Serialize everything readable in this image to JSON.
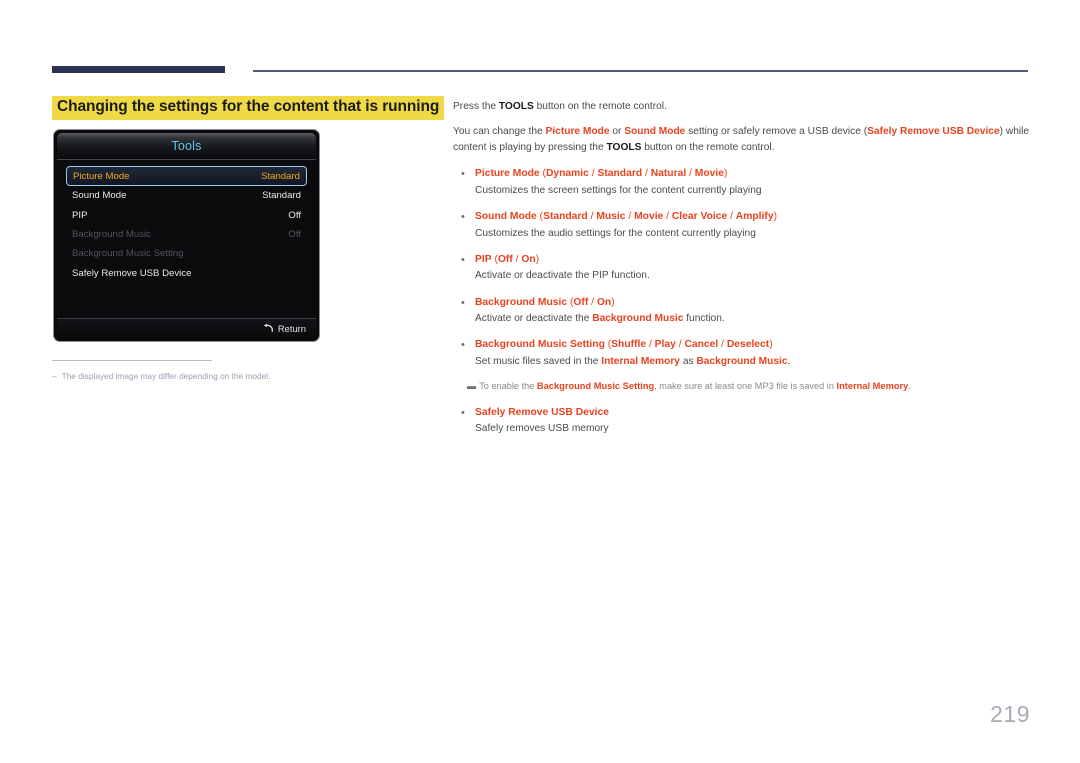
{
  "page": {
    "number": "219"
  },
  "heading": {
    "text": "Changing the settings for the content that is running"
  },
  "osd": {
    "title": "Tools",
    "rows": [
      {
        "label": "Picture Mode",
        "value": "Standard",
        "state": "selected"
      },
      {
        "label": "Sound Mode",
        "value": "Standard",
        "state": "normal"
      },
      {
        "label": "PIP",
        "value": "Off",
        "state": "normal"
      },
      {
        "label": "Background Music",
        "value": "Off",
        "state": "disabled"
      },
      {
        "label": "Background Music Setting",
        "value": "",
        "state": "disabled"
      },
      {
        "label": "Safely Remove USB Device",
        "value": "",
        "state": "normal"
      }
    ],
    "footer": {
      "return_label": "Return",
      "return_icon": "return-arrow-icon"
    }
  },
  "footnote": {
    "dash": "‒",
    "text": "The displayed image may differ depending on the model."
  },
  "body": {
    "para1": {
      "p1": "Press the ",
      "k1": "TOOLS",
      "p2": " button on the remote control."
    },
    "para2": {
      "p1": "You can change the ",
      "r1": "Picture Mode",
      "p2": " or ",
      "r2": "Sound Mode",
      "p3": " setting or safely remove a USB device (",
      "r3": "Safely Remove USB Device",
      "p4": ") while content is playing by pressing the ",
      "k1": "TOOLS",
      "p5": " button on the remote control."
    },
    "bullets": [
      {
        "marker": "•",
        "title": "Picture Mode",
        "options_open": " (",
        "options": [
          "Dynamic",
          "Standard",
          "Natural",
          "Movie"
        ],
        "options_close": ")",
        "desc_parts": [
          {
            "t": "Customizes the screen settings for the content currently playing",
            "s": "plain"
          }
        ]
      },
      {
        "marker": "•",
        "title": "Sound Mode",
        "options_open": " (",
        "options": [
          "Standard",
          "Music",
          "Movie",
          "Clear Voice",
          "Amplify"
        ],
        "options_close": ")",
        "desc_parts": [
          {
            "t": "Customizes the audio settings for the content currently playing",
            "s": "plain"
          }
        ]
      },
      {
        "marker": "•",
        "title": "PIP",
        "options_open": " (",
        "options": [
          "Off",
          "On"
        ],
        "options_close": ")",
        "desc_parts": [
          {
            "t": "Activate or deactivate the PIP function.",
            "s": "plain"
          }
        ]
      },
      {
        "marker": "•",
        "title": "Background Music",
        "options_open": " (",
        "options": [
          "Off",
          "On"
        ],
        "options_close": ")",
        "desc_parts": [
          {
            "t": "Activate or deactivate the ",
            "s": "plain"
          },
          {
            "t": "Background Music",
            "s": "red"
          },
          {
            "t": " function.",
            "s": "plain"
          }
        ]
      },
      {
        "marker": "•",
        "title": "Background Music Setting",
        "options_open": " (",
        "options": [
          "Shuffle",
          "Play",
          "Cancel",
          "Deselect"
        ],
        "options_close": ")",
        "desc_parts": [
          {
            "t": "Set music files saved in the ",
            "s": "plain"
          },
          {
            "t": "Internal Memory",
            "s": "red"
          },
          {
            "t": " as ",
            "s": "plain"
          },
          {
            "t": "Background Music",
            "s": "red"
          },
          {
            "t": ".",
            "s": "plain"
          }
        ]
      }
    ],
    "note": {
      "dash": "▬",
      "parts": [
        {
          "t": "To enable the ",
          "s": "plain"
        },
        {
          "t": "Background Music Setting",
          "s": "red"
        },
        {
          "t": ", make sure at least one MP3 file is saved in ",
          "s": "plain"
        },
        {
          "t": "Internal Memory",
          "s": "red"
        },
        {
          "t": ".",
          "s": "plain"
        }
      ]
    },
    "last_bullet": {
      "marker": "•",
      "title": "Safely Remove USB Device",
      "desc": "Safely removes USB memory"
    }
  },
  "colors": {
    "accent_red": "#e8431f",
    "heading_highlight": "#efd945",
    "rule_navy": "#2b3252",
    "osd_title_blue": "#61c7f2",
    "osd_selected_amber": "#f3a71c"
  }
}
